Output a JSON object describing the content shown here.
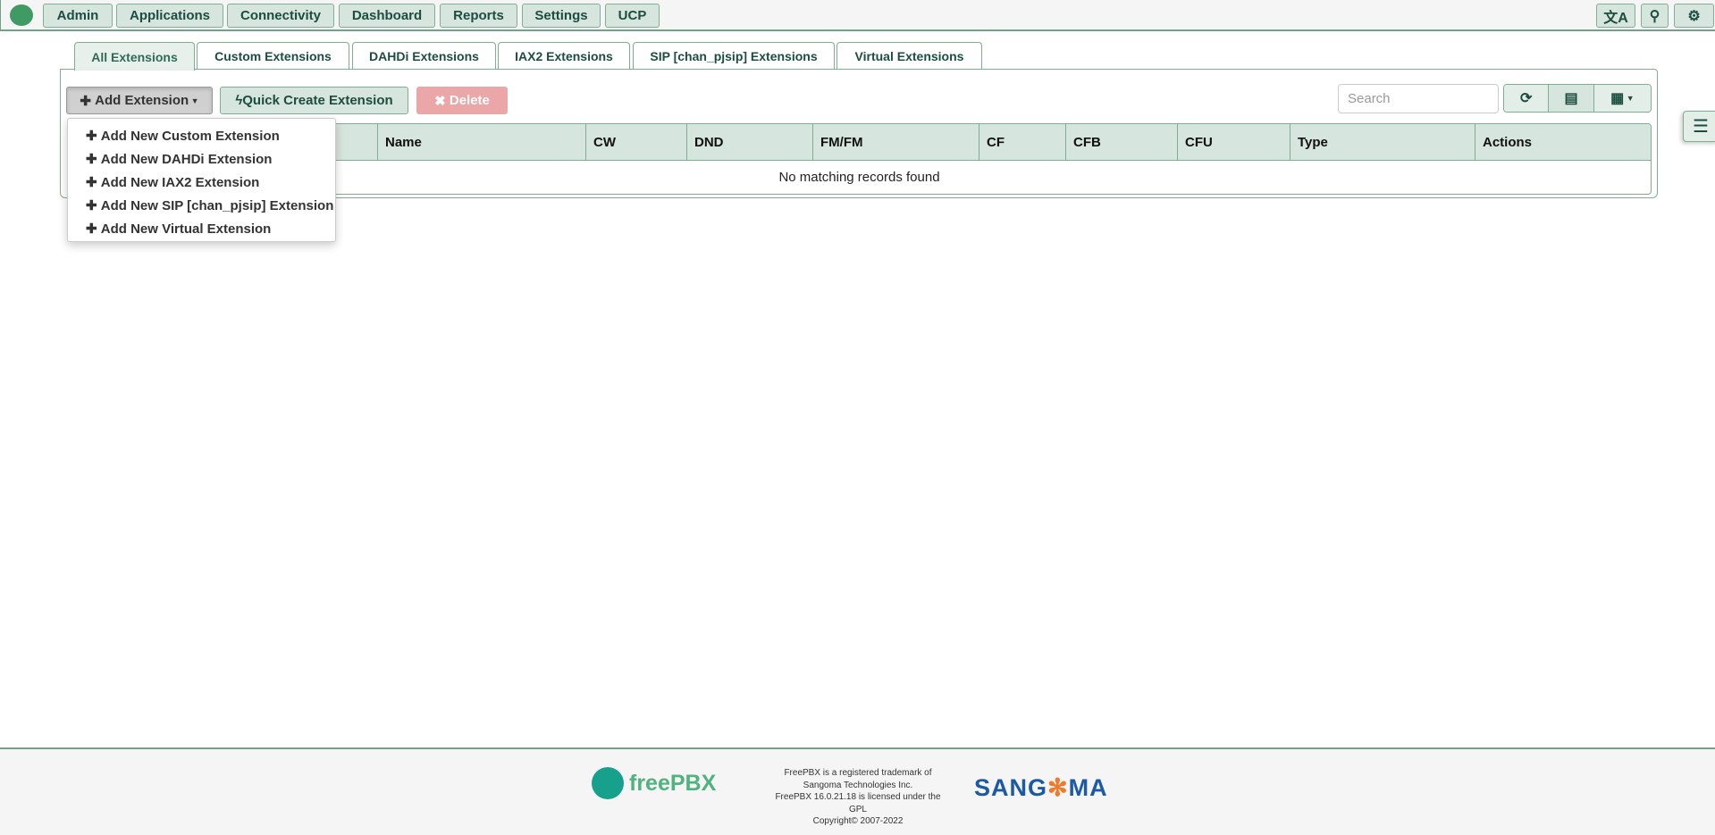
{
  "nav": {
    "items": [
      "Admin",
      "Applications",
      "Connectivity",
      "Dashboard",
      "Reports",
      "Settings",
      "UCP"
    ],
    "icons": [
      "translate-icon",
      "search-icon",
      "gear-icon"
    ]
  },
  "tabs": [
    "All Extensions",
    "Custom Extensions",
    "DAHDi Extensions",
    "IAX2 Extensions",
    "SIP [chan_pjsip] Extensions",
    "Virtual Extensions"
  ],
  "toolbar": {
    "add_label": "Add Extension",
    "quick_label": "Quick Create Extension",
    "delete_label": "Delete",
    "search_placeholder": "Search"
  },
  "dropdown": [
    "Add New Custom Extension",
    "Add New DAHDi Extension",
    "Add New IAX2 Extension",
    "Add New SIP [chan_pjsip] Extension",
    "Add New Virtual Extension"
  ],
  "table": {
    "columns": [
      "",
      "Name",
      "CW",
      "DND",
      "FM/FM",
      "CF",
      "CFB",
      "CFU",
      "Type",
      "Actions"
    ],
    "empty": "No matching records found"
  },
  "footer": {
    "brand": "freePBX",
    "lines": [
      "FreePBX is a registered trademark of",
      "Sangoma Technologies Inc.",
      "FreePBX 16.0.21.18 is licensed under the",
      "GPL",
      "Copyright© 2007-2022"
    ],
    "sangoma_a": "SANG",
    "sangoma_b": "MA"
  },
  "colors": {
    "accent": "#7fae92",
    "nav_bg": "#d6e5dd",
    "delete": "#eba7a7"
  }
}
